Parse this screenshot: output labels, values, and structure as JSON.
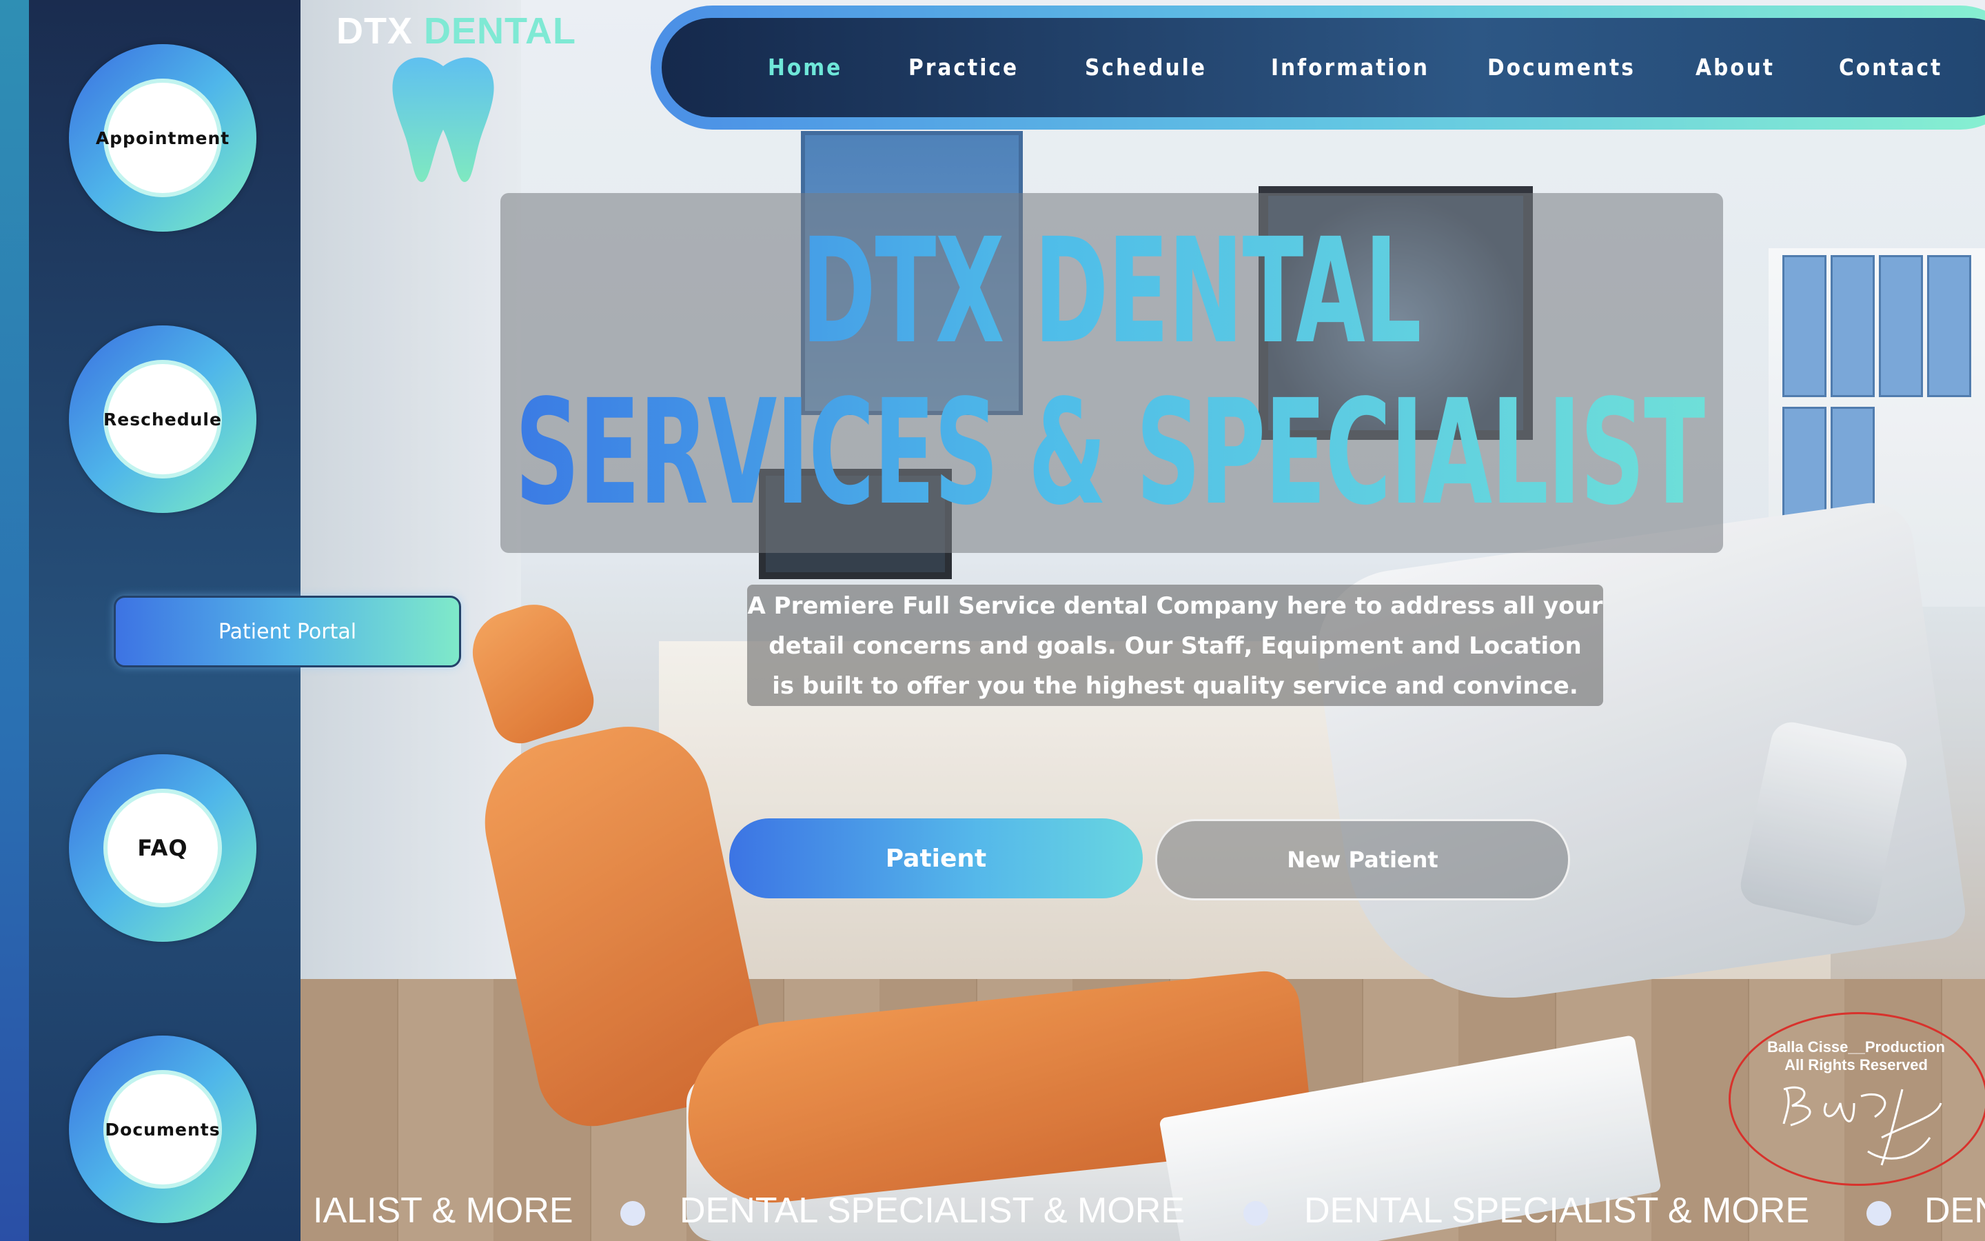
{
  "logo": {
    "part1": "DTX",
    "part2": "DENTAL"
  },
  "nav": {
    "items": [
      {
        "label": "Home",
        "active": true
      },
      {
        "label": "Practice",
        "active": false
      },
      {
        "label": "Schedule",
        "active": false
      },
      {
        "label": "Information",
        "active": false
      },
      {
        "label": "Documents",
        "active": false
      },
      {
        "label": "About",
        "active": false
      },
      {
        "label": "Contact",
        "active": false
      }
    ]
  },
  "sidebar": {
    "circles": [
      {
        "label": "Appointment"
      },
      {
        "label": "Reschedule"
      },
      {
        "label": "FAQ"
      },
      {
        "label": "Documents"
      }
    ],
    "portal_button": "Patient Portal"
  },
  "hero": {
    "title_line1": "DTX DENTAL",
    "title_line2": "SERVICES & SPECIALIST",
    "description": [
      "A Premiere Full Service dental Company here to address all your",
      "detail concerns and goals. Our Staff, Equipment and Location",
      "is built to offer you the highest quality service and convince."
    ],
    "patient_button": "Patient",
    "new_patient_button": "New Patient"
  },
  "stamp": {
    "line1": "Balla Cisse__Production",
    "line2": "All Rights Reserved"
  },
  "marquee": {
    "items": [
      "IALIST & MORE",
      "DENTAL SPECIALIST & MORE",
      "DENTAL SPECIALIST & MORE",
      "DEN"
    ]
  },
  "colors": {
    "accent_teal": "#7fe9d4",
    "accent_blue": "#3d73e3",
    "sidebar_dark": "#1a2c4f",
    "stamp_red": "#d8322c"
  },
  "icons": [
    "tooth-logo-icon",
    "signature-icon"
  ]
}
